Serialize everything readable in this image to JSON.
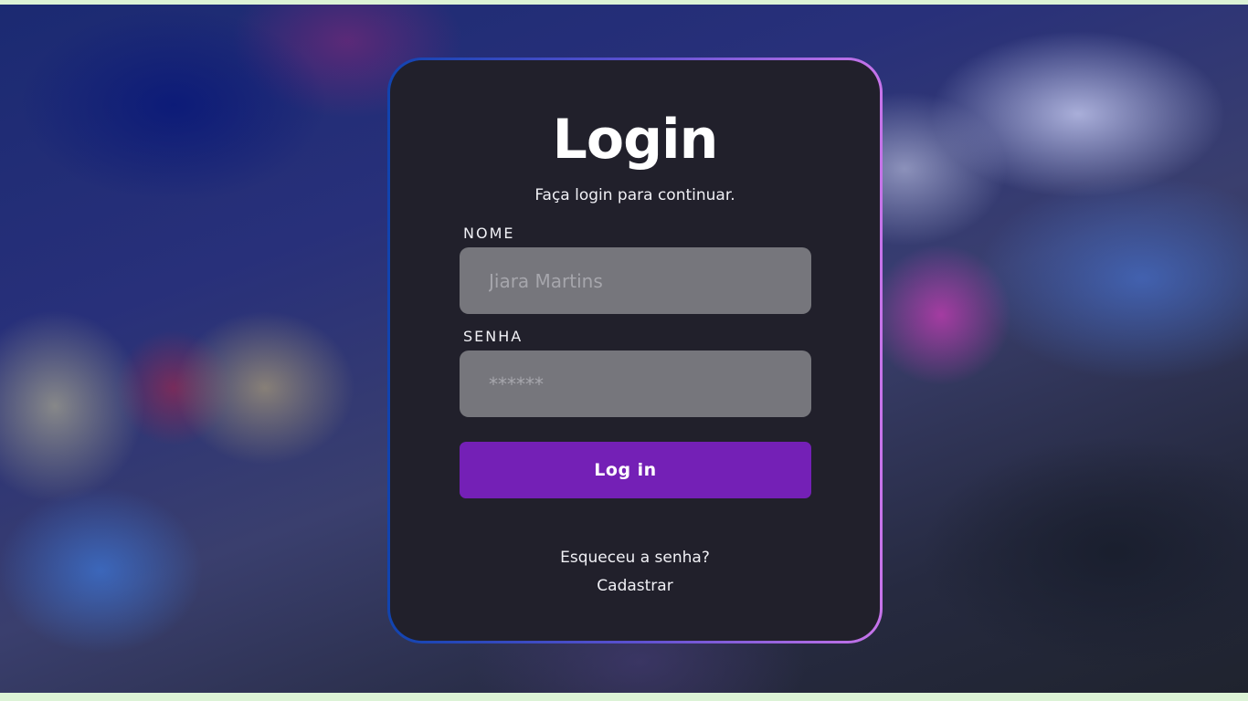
{
  "login": {
    "title": "Login",
    "subtitle": "Faça login para continuar.",
    "name_label": "NOME",
    "name_placeholder": "Jiara Martins",
    "password_label": "SENHA",
    "password_placeholder": "******",
    "submit_label": "Log in",
    "forgot_password_label": "Esqueceu a senha?",
    "register_label": "Cadastrar"
  },
  "colors": {
    "card_background": "#21202b",
    "accent": "#7420b6",
    "border_gradient_start": "#1144b0",
    "border_gradient_end": "#c774ea",
    "input_background": "#76767c"
  }
}
